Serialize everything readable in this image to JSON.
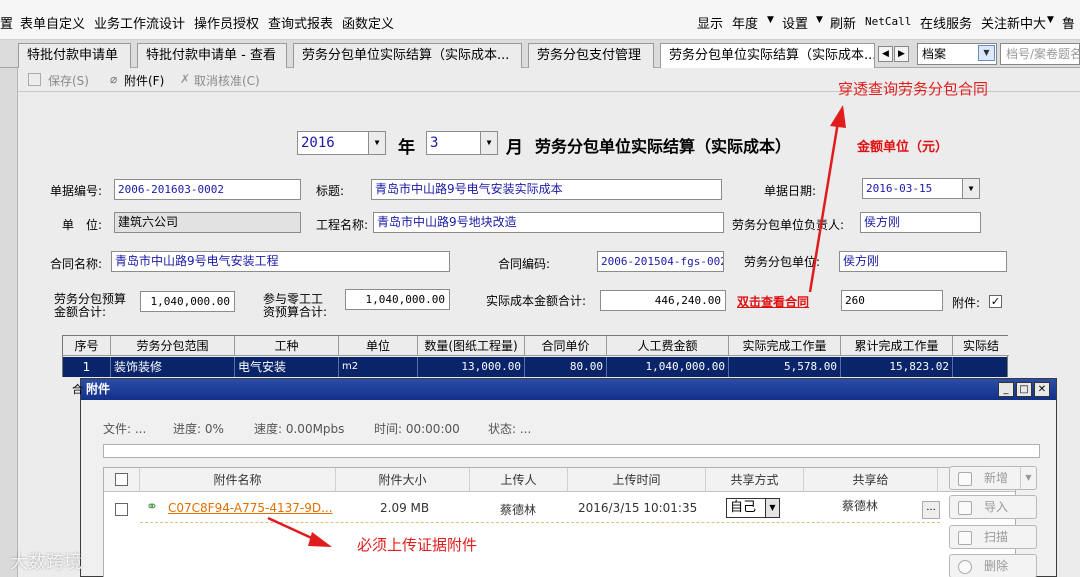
{
  "menu": {
    "left_items": [
      "置",
      "表单自定义",
      "业务工作流设计",
      "操作员授权",
      "查询式报表",
      "函数定义"
    ],
    "right_items": [
      "显示",
      "年度",
      "设置",
      "刷新",
      "NetCall",
      "在线服务",
      "关注新中大",
      "鲁"
    ]
  },
  "tabs": [
    {
      "label": "特批付款申请单"
    },
    {
      "label": "特批付款申请单 - 查看"
    },
    {
      "label": "劳务分包单位实际结算（实际成本..."
    },
    {
      "label": "劳务分包支付管理"
    },
    {
      "label": "劳务分包单位实际结算（实际成本..."
    }
  ],
  "archive_box": {
    "value": "档案",
    "placeholder": "档号/案卷题名"
  },
  "toolbar": {
    "save": "保存(S)",
    "attach": "附件(F)",
    "uncheck": "取消核准(C)"
  },
  "form": {
    "year": "2016",
    "year_label": "年",
    "month": "3",
    "month_label": "月",
    "title": "劳务分包单位实际结算（实际成本）",
    "unit_note": "金额单位（元）",
    "doc_no_label": "单据编号:",
    "doc_no": "2006-201603-0002",
    "subject_label": "标题:",
    "subject": "青岛市中山路9号电气安装实际成本",
    "doc_date_label": "单据日期:",
    "doc_date": "2016-03-15",
    "unit_label": "单　位:",
    "unit": "建筑六公司",
    "project_label": "工程名称:",
    "project": "青岛市中山路9号地块改造",
    "owner_label": "劳务分包单位负责人:",
    "owner": "侯方刚",
    "contract_label": "合同名称:",
    "contract": "青岛市中山路9号电气安装工程",
    "contract_no_label": "合同编码:",
    "contract_no": "2006-201504-fgs-002",
    "sub_unit_label": "劳务分包单位:",
    "sub_unit": "侯方刚",
    "budget_label_1": "劳务分包预算",
    "budget_label_2": "金额合计:",
    "budget": "1,040,000.00",
    "labor_label_1": "参与零工工",
    "labor_label_2": "资预算合计:",
    "labor": "1,040,000.00",
    "actual_label": "实际成本金额合计:",
    "actual": "446,240.00",
    "dblclick_label": "双击查看合同",
    "contract_ref": "260",
    "attach_label": "附件:"
  },
  "grid": {
    "headers": [
      "序号",
      "劳务分包范围",
      "工种",
      "单位",
      "数量(图纸工程量)",
      "合同单价",
      "人工费金额",
      "实际完成工作量",
      "累计完成工作量",
      "实际结"
    ],
    "row": [
      "1",
      "装饰装修",
      "电气安装",
      "m2",
      "13,000.00",
      "80.00",
      "1,040,000.00",
      "5,578.00",
      "15,823.02",
      ""
    ]
  },
  "dialog": {
    "title": "附件",
    "file": "文件: ...",
    "progress": "进度: 0%",
    "speed": "速度: 0.00Mpbs",
    "time": "时间: 00:00:00",
    "state": "状态: ...",
    "headers": [
      "附件名称",
      "附件大小",
      "上传人",
      "上传时间",
      "共享方式",
      "共享给"
    ],
    "row": {
      "name": "C07C8F94-A775-4137-9D...",
      "size": "2.09 MB",
      "uploader": "蔡德林",
      "time": "2016/3/15 10:01:35",
      "share_mode": "自己",
      "share_to": "蔡德林"
    },
    "buttons": {
      "add": "新增",
      "import": "导入",
      "scan": "扫描",
      "delete": "删除"
    }
  },
  "annotations": {
    "top": "穿透查询劳务分包合同",
    "bottom": "必须上传证据附件"
  },
  "watermark": "大数跨境",
  "colors": {
    "annotation": "#e01c1c",
    "selected_row": "#0a246a",
    "link": "#e07000"
  }
}
